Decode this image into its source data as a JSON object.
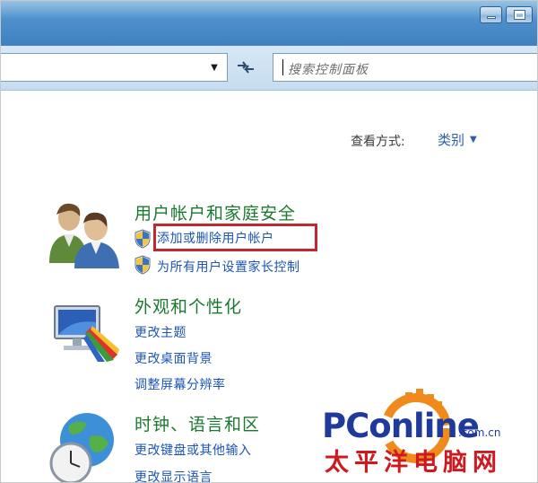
{
  "window": {
    "buttons": [
      "minimize",
      "maximize"
    ]
  },
  "navbar": {
    "address_value": "",
    "search_placeholder": "搜索控制面板"
  },
  "view": {
    "label": "查看方式:",
    "value": "类别"
  },
  "categories": [
    {
      "title": "用户帐户和家庭安全",
      "icon": "users-icon",
      "links": [
        {
          "label": "添加或删除用户帐户",
          "shield": true,
          "highlighted": true
        },
        {
          "label": "为所有用户设置家长控制",
          "shield": true
        }
      ]
    },
    {
      "title": "外观和个性化",
      "icon": "appearance-icon",
      "links": [
        {
          "label": "更改主题"
        },
        {
          "label": "更改桌面背景"
        },
        {
          "label": "调整屏幕分辨率"
        }
      ]
    },
    {
      "title": "时钟、语言和区",
      "icon": "clock-globe-icon",
      "links": [
        {
          "label": "更改键盘或其他输入"
        },
        {
          "label": "更改显示语言"
        }
      ]
    }
  ],
  "watermark": {
    "word": "PConline",
    "domain": ".com.cn",
    "cn": "太平洋电脑网"
  },
  "colors": {
    "category_title": "#1a7a2f",
    "link": "#1c55b5",
    "highlight": "#c3262e",
    "titlebar": "#4c8fcb"
  }
}
